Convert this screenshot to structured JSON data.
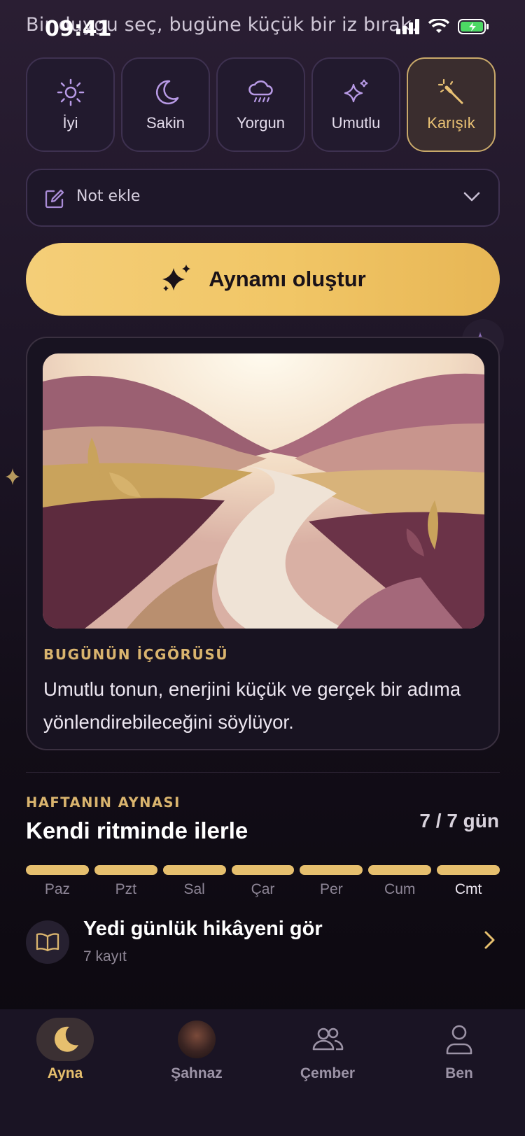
{
  "status_bar": {
    "time": "09:41"
  },
  "header": {
    "subtitle": "Bir duygu seç, bugüne küçük bir iz bırak."
  },
  "moods": [
    {
      "icon": "sun-icon",
      "label": "İyi",
      "selected": false
    },
    {
      "icon": "moon-icon",
      "label": "Sakin",
      "selected": false
    },
    {
      "icon": "rain-cloud-icon",
      "label": "Yorgun",
      "selected": false
    },
    {
      "icon": "sparkles-icon",
      "label": "Umutlu",
      "selected": false
    },
    {
      "icon": "magic-wand-icon",
      "label": "Karışık",
      "selected": true
    }
  ],
  "note": {
    "label": "Not ekle"
  },
  "cta": {
    "label": "Aynamı oluştur"
  },
  "insight": {
    "heading": "BUGÜNÜN İÇGÖRÜSÜ",
    "body": "Umutlu tonun, enerjini küçük ve gerçek bir adıma yönlendirebileceğini söylüyor."
  },
  "week": {
    "heading": "HAFTANIN AYNASI",
    "title": "Kendi ritminde ilerle",
    "count": "7 / 7 gün",
    "days": [
      "Paz",
      "Pzt",
      "Sal",
      "Çar",
      "Per",
      "Cum",
      "Cmt"
    ],
    "completed": 7
  },
  "story": {
    "title": "Yedi günlük hikâyeni gör",
    "subtitle": "7 kayıt"
  },
  "tabs": [
    {
      "label": "Ayna",
      "active": true
    },
    {
      "label": "Şahnaz",
      "active": false
    },
    {
      "label": "Çember",
      "active": false
    },
    {
      "label": "Ben",
      "active": false
    }
  ],
  "colors": {
    "accent": "#e6bf6e",
    "background": "#1d1526",
    "card": "#181321"
  }
}
